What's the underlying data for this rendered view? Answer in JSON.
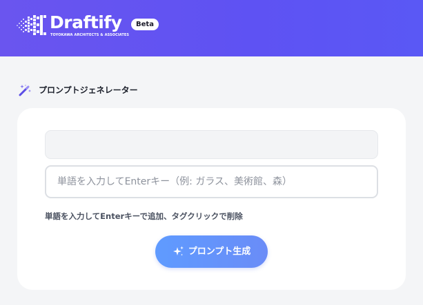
{
  "header": {
    "logo_word": "Draftify",
    "logo_subtitle": "TOYOKAWA ARCHITECTS & ASSOCIATES",
    "beta_badge": "Beta"
  },
  "section": {
    "title": "プロンプトジェネレーター",
    "icon": "magic-wand-icon"
  },
  "form": {
    "word_input_value": "",
    "word_input_placeholder": "単語を入力してEnterキー（例: ガラス、美術館、森）",
    "hint": "単語を入力してEnterキーで追加、タグクリックで削除",
    "generate_button_label": "プロンプト生成",
    "generate_button_icon": "sparkle-icon"
  },
  "colors": {
    "header_gradient_start": "#6a55ef",
    "header_gradient_end": "#5a58f5",
    "button_gradient_start": "#5f9bff",
    "button_gradient_end": "#6a8cf7",
    "page_background": "#f4f5f7"
  }
}
